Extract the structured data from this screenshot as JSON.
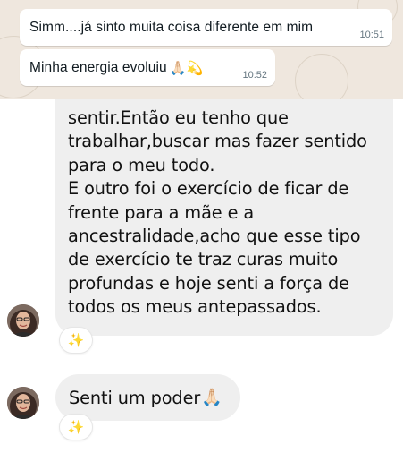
{
  "whatsapp": {
    "messages": [
      {
        "text": "Simm....já  sinto muita coisa diferente  em mim",
        "emoji": "",
        "time": "10:51"
      },
      {
        "text": "Minha energia evoluiu ",
        "emoji": "🙏🏻💫",
        "time": "10:52"
      }
    ]
  },
  "instagram": {
    "message_1_lines": [
      "sentir.Então eu tenho que",
      "trabalhar,buscar mas fazer sentido",
      "para o meu todo.",
      "E outro foi o exercício de ficar de",
      "frente para a mãe e a",
      "ancestralidade,acho que esse tipo",
      "de exercício te traz curas muito",
      "profundas e hoje senti a força de",
      "todos os meus antepassados."
    ],
    "message_1_reaction": "✨",
    "message_2_text": "Senti um poder",
    "message_2_emoji": "🙏🏻",
    "message_2_reaction": "✨"
  },
  "colors": {
    "whatsapp_background": "#efe7de",
    "whatsapp_bubble": "#ffffff",
    "instagram_bubble": "#efefef",
    "timestamp": "#667781"
  },
  "icons": [
    "avatar-photo",
    "sparkles-reaction-icon",
    "praying-hands-emoji",
    "dizzy-star-emoji"
  ]
}
